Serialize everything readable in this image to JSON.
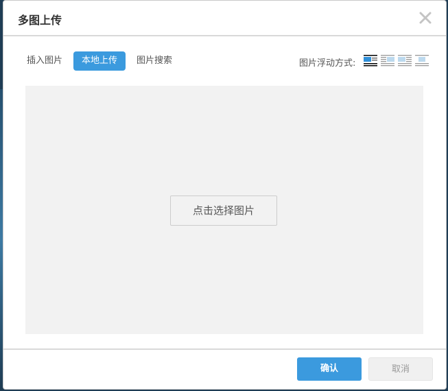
{
  "dialog": {
    "title": "多图上传"
  },
  "tabs": [
    {
      "label": "插入图片",
      "active": false
    },
    {
      "label": "本地上传",
      "active": true
    },
    {
      "label": "图片搜索",
      "active": false
    }
  ],
  "float": {
    "label": "图片浮动方式:",
    "options": [
      "float-none-icon",
      "float-left-icon",
      "float-right-icon",
      "float-center-icon"
    ]
  },
  "upload": {
    "select_label": "点击选择图片"
  },
  "footer": {
    "confirm_label": "确认",
    "cancel_label": "取消"
  },
  "colors": {
    "accent": "#3b9ade",
    "upload_bg": "#f2f2f2"
  }
}
